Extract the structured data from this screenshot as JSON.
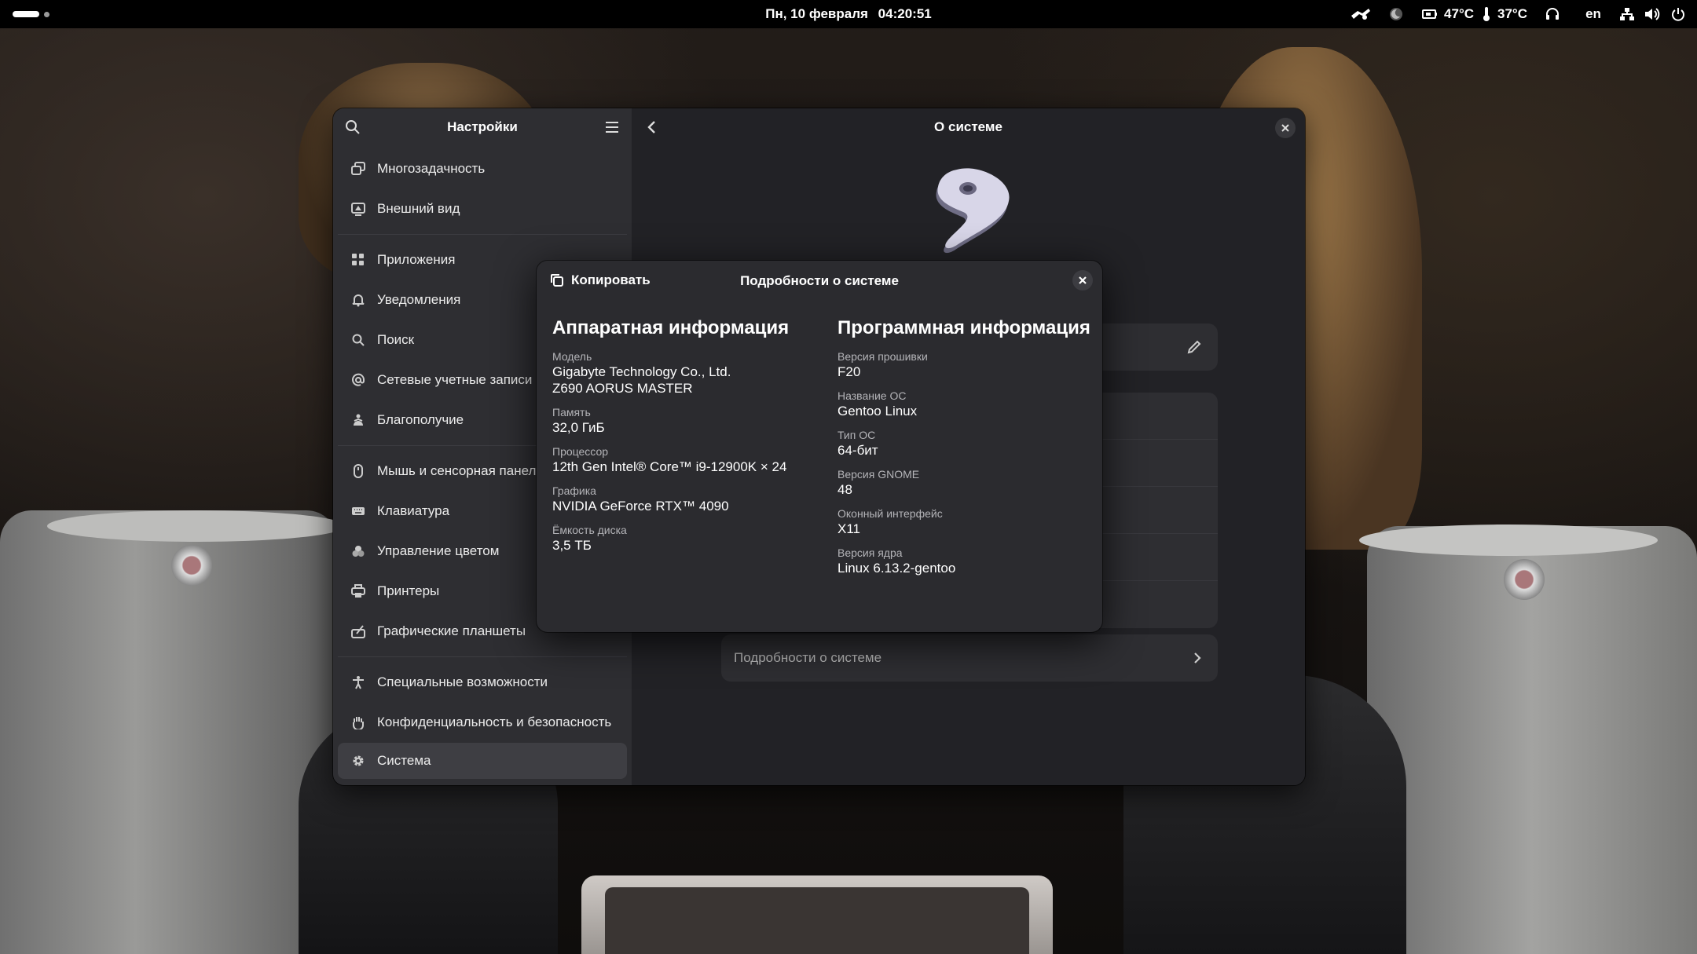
{
  "topbar": {
    "date": "Пн, 10 февраля",
    "time": "04:20:51",
    "gpu_temp": "47°C",
    "cpu_temp": "37°C",
    "keyboard_layout": "en",
    "icons": [
      "weather-icon",
      "night-light-icon",
      "gpu-icon",
      "thermometer-icon",
      "headset-icon",
      "network-icon",
      "volume-icon",
      "power-icon"
    ]
  },
  "sidebar": {
    "title": "Настройки",
    "items": [
      {
        "label": "Многозадачность",
        "icon": "multitasking-icon"
      },
      {
        "label": "Внешний вид",
        "icon": "appearance-icon"
      },
      {
        "label": "Приложения",
        "icon": "apps-icon"
      },
      {
        "label": "Уведомления",
        "icon": "bell-icon"
      },
      {
        "label": "Поиск",
        "icon": "search-icon"
      },
      {
        "label": "Сетевые учетные записи",
        "icon": "at-icon"
      },
      {
        "label": "Благополучие",
        "icon": "wellbeing-icon"
      },
      {
        "label": "Мышь и сенсорная панель",
        "icon": "mouse-icon"
      },
      {
        "label": "Клавиатура",
        "icon": "keyboard-icon"
      },
      {
        "label": "Управление цветом",
        "icon": "color-icon"
      },
      {
        "label": "Принтеры",
        "icon": "printer-icon"
      },
      {
        "label": "Графические планшеты",
        "icon": "tablet-icon"
      },
      {
        "label": "Специальные возможности",
        "icon": "accessibility-icon"
      },
      {
        "label": "Конфиденциальность и безопасность",
        "icon": "hand-icon"
      },
      {
        "label": "Система",
        "icon": "gear-icon"
      }
    ],
    "active": "Система"
  },
  "main": {
    "title": "О системе",
    "details_row_label": "Подробности о системе"
  },
  "dialog": {
    "copy_label": "Копировать",
    "title": "Подробности о системе",
    "hardware": {
      "heading": "Аппаратная информация",
      "fields": [
        {
          "label": "Модель",
          "value": "Gigabyte Technology Co., Ltd. Z690 AORUS MASTER"
        },
        {
          "label": "Память",
          "value": "32,0 ГиБ"
        },
        {
          "label": "Процессор",
          "value": "12th Gen Intel® Core™ i9-12900K × 24"
        },
        {
          "label": "Графика",
          "value": "NVIDIA GeForce RTX™ 4090"
        },
        {
          "label": "Ёмкость диска",
          "value": "3,5 ТБ"
        }
      ]
    },
    "software": {
      "heading": "Программная информация",
      "fields": [
        {
          "label": "Версия прошивки",
          "value": "F20"
        },
        {
          "label": "Название ОС",
          "value": "Gentoo Linux"
        },
        {
          "label": "Тип ОС",
          "value": "64-бит"
        },
        {
          "label": "Версия GNOME",
          "value": "48"
        },
        {
          "label": "Оконный интерфейс",
          "value": "X11"
        },
        {
          "label": "Версия ядра",
          "value": "Linux 6.13.2-gentoo"
        }
      ]
    }
  },
  "colors": {
    "window_bg": "#222226",
    "sidebar_bg": "#2e2e32",
    "dialog_bg": "#2b2b2f",
    "topbar_bg": "#000000"
  }
}
